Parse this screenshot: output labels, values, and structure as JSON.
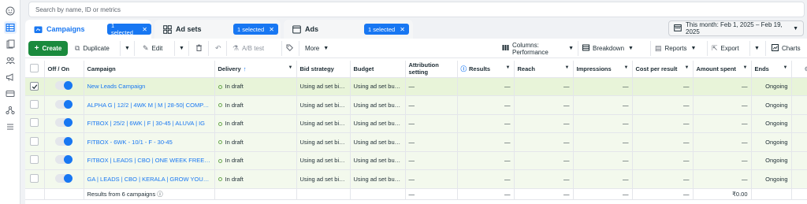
{
  "search": {
    "placeholder": "Search by name, ID or metrics"
  },
  "tabs": [
    {
      "label": "Campaigns",
      "selection": "1 selected"
    },
    {
      "label": "Ad sets",
      "selection": "1 selected"
    },
    {
      "label": "Ads",
      "selection": "1 selected"
    }
  ],
  "date_range": "This month: Feb 1, 2025 – Feb 19, 2025",
  "toolbar": {
    "create": "Create",
    "duplicate": "Duplicate",
    "edit": "Edit",
    "ab_test": "A/B test",
    "more": "More",
    "columns": "Columns: Performance",
    "breakdown": "Breakdown",
    "reports": "Reports",
    "export": "Export",
    "charts": "Charts"
  },
  "columns": [
    "Off / On",
    "Campaign",
    "Delivery",
    "Bid strategy",
    "Budget",
    "Attribution setting",
    "Results",
    "Reach",
    "Impressions",
    "Cost per result",
    "Amount spent",
    "Ends"
  ],
  "rows": [
    {
      "campaign": "New Leads Campaign",
      "delivery": "In draft",
      "bid": "Using ad set bid ...",
      "budget": "Using ad set bud...",
      "attribution": "—",
      "results": "—",
      "reach": "—",
      "impressions": "—",
      "cpr": "—",
      "spent": "—",
      "ends": "Ongoing",
      "checked": true
    },
    {
      "campaign": "ALPHA G | 12/2 | 4WK M | M | 28-50| COMPAN...",
      "delivery": "In draft",
      "bid": "Using ad set bid ...",
      "budget": "Using ad set bud...",
      "attribution": "—",
      "results": "—",
      "reach": "—",
      "impressions": "—",
      "cpr": "—",
      "spent": "—",
      "ends": "Ongoing",
      "checked": false
    },
    {
      "campaign": "FITBOX | 25/2 | 6WK | F | 30-45 | ALUVA | IG",
      "delivery": "In draft",
      "bid": "Using ad set bid ...",
      "budget": "Using ad set bud...",
      "attribution": "—",
      "results": "—",
      "reach": "—",
      "impressions": "—",
      "cpr": "—",
      "spent": "—",
      "ends": "Ongoing",
      "checked": false
    },
    {
      "campaign": "FITBOX - 6WK - 10/1 - F - 30-45",
      "delivery": "In draft",
      "bid": "Using ad set bid ...",
      "budget": "Using ad set bud...",
      "attribution": "—",
      "results": "—",
      "reach": "—",
      "impressions": "—",
      "cpr": "—",
      "spent": "—",
      "ends": "Ongoing",
      "checked": false
    },
    {
      "campaign": "FITBOX | LEADS | CBO | ONE WEEK FREE TRAIL |...",
      "delivery": "In draft",
      "bid": "Using ad set bid ...",
      "budget": "Using ad set bud...",
      "attribution": "—",
      "results": "—",
      "reach": "—",
      "impressions": "—",
      "cpr": "—",
      "spent": "—",
      "ends": "Ongoing",
      "checked": false
    },
    {
      "campaign": "GA | LEADS | CBO | KERALA | GROW YOUR GYM",
      "delivery": "In draft",
      "bid": "Using ad set bid ...",
      "budget": "Using ad set bud...",
      "attribution": "—",
      "results": "—",
      "reach": "—",
      "impressions": "—",
      "cpr": "—",
      "spent": "—",
      "ends": "Ongoing",
      "checked": false
    }
  ],
  "footer": {
    "label": "Results from 6 campaigns",
    "attribution": "—",
    "results": "—",
    "reach": "—",
    "impressions": "—",
    "cpr": "—",
    "spent": "₹0.00"
  },
  "colors": {
    "accent": "#1877f2",
    "create": "#1a8a3d",
    "row_bg": "#f3f9ed",
    "draft_dot": "#6aa84f"
  }
}
